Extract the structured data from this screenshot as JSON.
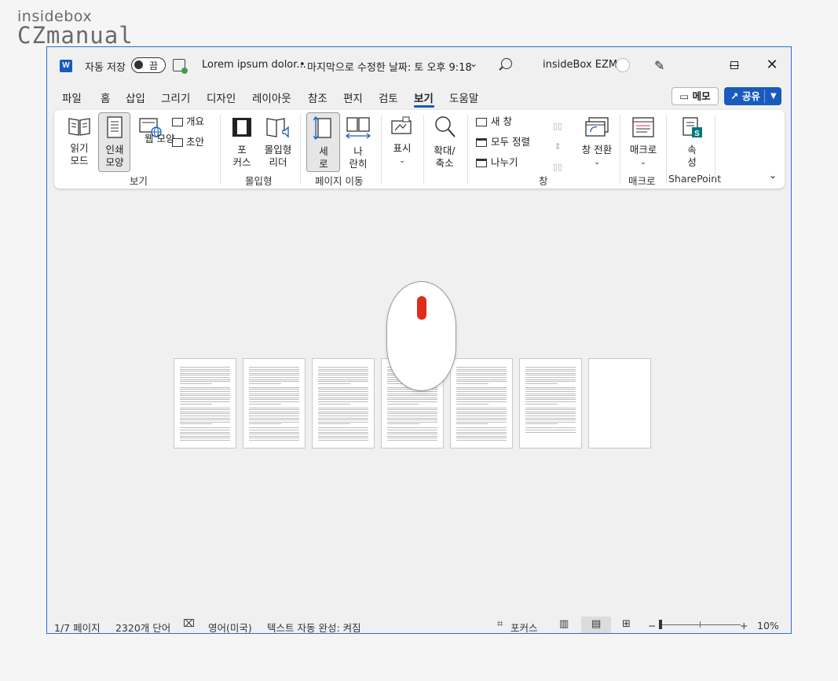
{
  "brand": {
    "line1": "insidebox",
    "line2": "CZmanual"
  },
  "titlebar": {
    "autosave_label": "자동 저장",
    "toggle_state": "끔",
    "doc_title": "Lorem ipsum dolor...",
    "dot": "•",
    "modified": "마지막으로 수정한 날짜: 토 오후 9:18",
    "user_name": "insideBox EZM"
  },
  "menu": {
    "tabs": [
      "파일",
      "홈",
      "삽입",
      "그리기",
      "디자인",
      "레이아웃",
      "참조",
      "편지",
      "검토",
      "보기",
      "도움말"
    ],
    "active_tab": "보기",
    "memo_label": "메모",
    "share_label": "공유"
  },
  "ribbon": {
    "views": {
      "read_mode": [
        "읽기",
        "모드"
      ],
      "print_layout": [
        "인쇄",
        "모양"
      ],
      "web_layout": "웹 모양",
      "outline": "개요",
      "draft": "초안",
      "group": "보기"
    },
    "immersive": {
      "focus": [
        "포",
        "커스"
      ],
      "immersive_reader": [
        "몰입형",
        "리더"
      ],
      "group": "몰입형"
    },
    "page_movement": {
      "vertical": [
        "세",
        "로"
      ],
      "side_by_side": [
        "나",
        "란히"
      ],
      "group": "페이지 이동"
    },
    "show": "표시",
    "zoom": [
      "확대/",
      "축소"
    ],
    "window": {
      "new_window": "새 창",
      "arrange_all": "모두 정렬",
      "split": "나누기",
      "switch_windows": "창 전환",
      "group": "창"
    },
    "macros": {
      "label": "매크로",
      "group": "매크로"
    },
    "sharepoint": {
      "label": [
        "속",
        "성"
      ],
      "group": "SharePoint"
    }
  },
  "status": {
    "page": "1/7 페이지",
    "words": "2320개 단어",
    "language": "영어(미국)",
    "autocomplete": "텍스트 자동 완성: 켜짐",
    "focus": "포커스",
    "zoom_minus": "−",
    "zoom_plus": "+",
    "zoom_level": "10%"
  },
  "colors": {
    "accent": "#185abd",
    "window_border": "#2f6fd0",
    "mouse_wheel": "#e12a1a"
  },
  "document": {
    "page_count": 7
  }
}
